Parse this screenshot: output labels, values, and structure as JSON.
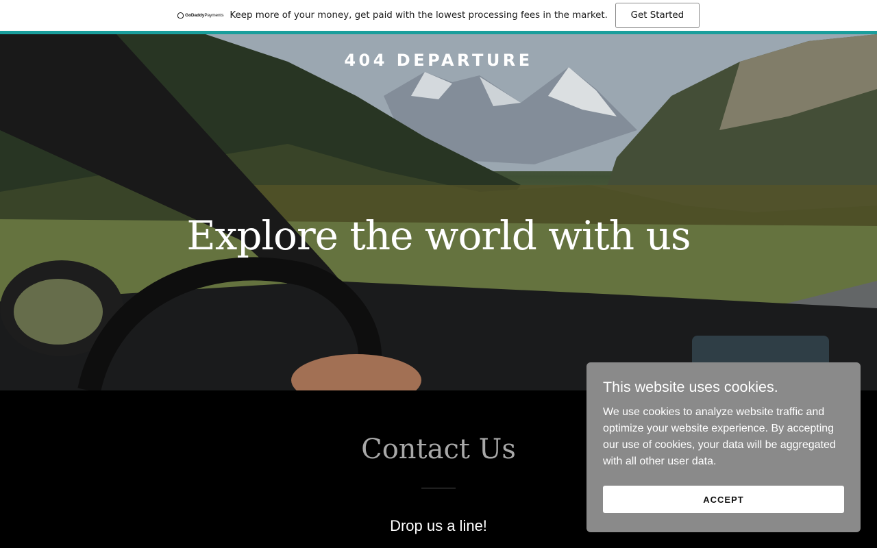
{
  "promo": {
    "logo_brand": "GoDaddy",
    "logo_product": "Payments",
    "text": "Keep more of your money, get paid with the lowest processing fees in the market.",
    "button_label": "Get Started",
    "accent_color": "#1a9e9c"
  },
  "hero": {
    "brand": "404 DEPARTURE",
    "title": "Explore the world with us"
  },
  "contact": {
    "title": "Contact Us",
    "subtitle": "Drop us a line!"
  },
  "cookie": {
    "title": "This website uses cookies.",
    "body": "We use cookies to analyze website traffic and optimize your website experience. By accepting our use of cookies, your data will be aggregated with all other user data.",
    "accept_label": "ACCEPT"
  }
}
